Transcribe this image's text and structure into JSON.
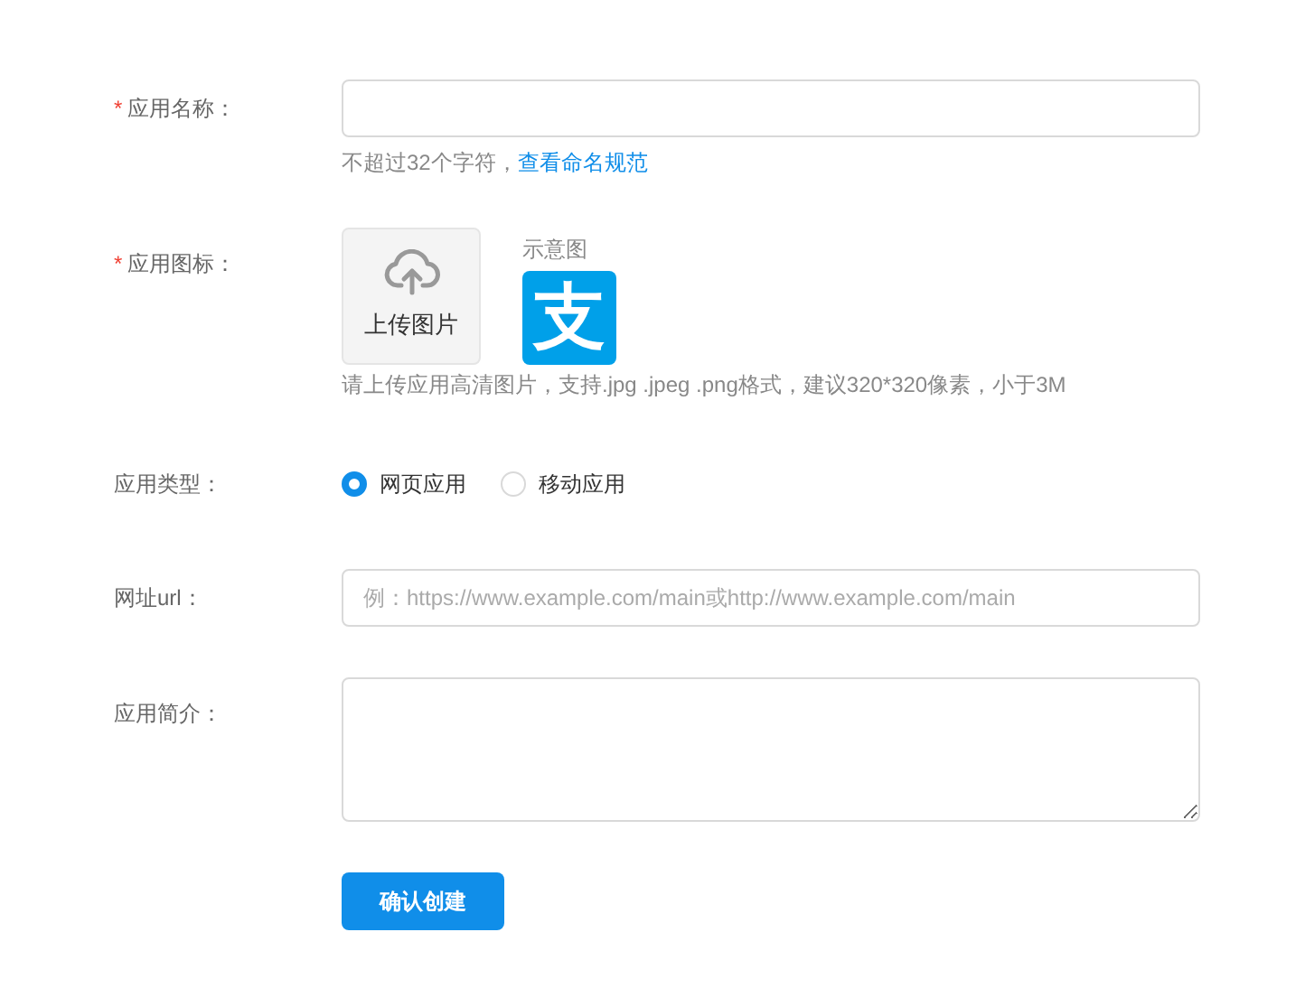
{
  "fields": [
    {
      "kind": "text",
      "label": "应用名称：",
      "required_mark": "*",
      "hint": "不超过32个字符，",
      "hint_link": "查看命名规范"
    },
    {
      "kind": "upload",
      "label": "应用图标：",
      "required_mark": "*",
      "upload_label": "上传图片",
      "sample_label": "示意图",
      "sample_logo_text": "支",
      "hint": "请上传应用高清图片，支持.jpg .jpeg .png格式，建议320*320像素，小于3M"
    },
    {
      "kind": "radio",
      "label": "应用类型：",
      "options": [
        {
          "label": "网页应用",
          "selected": true
        },
        {
          "label": "移动应用",
          "selected": false
        }
      ]
    },
    {
      "kind": "url",
      "label": "网址url：",
      "placeholder": "例：https://www.example.com/main或http://www.example.com/main"
    },
    {
      "kind": "textarea",
      "label": "应用简介："
    }
  ],
  "submit": "确认创建"
}
